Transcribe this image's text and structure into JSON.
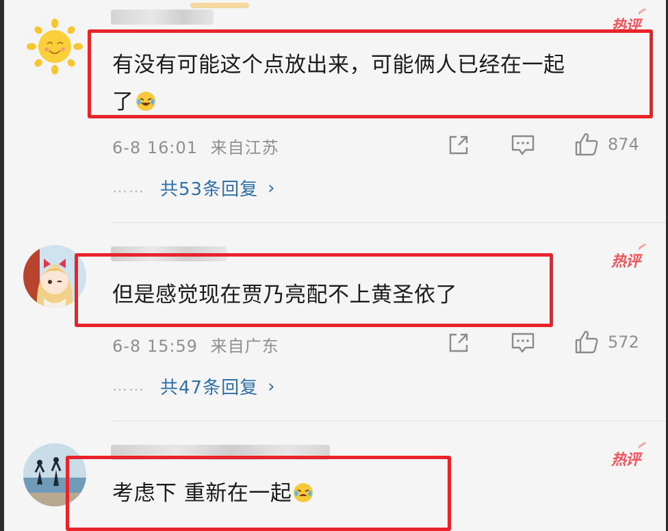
{
  "comments": [
    {
      "avatar": "sun-avatar",
      "hot_label": "热评",
      "text": "有没有可能这个点放出来，可能俩人已经在一起",
      "text_line2": "了",
      "emoji": "laughing-tears-emoji",
      "time": "6-8 16:01",
      "location": "来自江苏",
      "likes": "874",
      "replies_dots": "……",
      "replies": "共53条回复"
    },
    {
      "avatar": "girl-avatar",
      "hot_label": "热评",
      "text": "但是感觉现在贾乃亮配不上黄圣依了",
      "time": "6-8 15:59",
      "location": "来自广东",
      "likes": "572",
      "replies_dots": "……",
      "replies": "共47条回复"
    },
    {
      "avatar": "beach-avatar",
      "hot_label": "热评",
      "text": "考虑下 重新在一起",
      "emoji": "crying-laughing-emoji"
    }
  ],
  "colors": {
    "highlight": "#e8232a",
    "link": "#2f6fa7",
    "hot": "#f2545b"
  }
}
